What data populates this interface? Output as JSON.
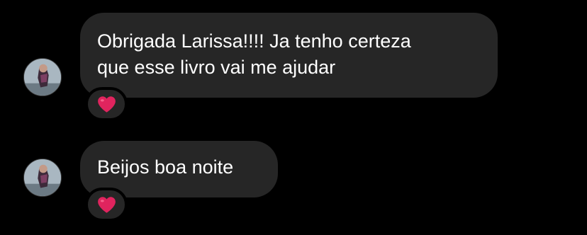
{
  "messages": [
    {
      "lines": [
        "Obrigada Larissa!!!! Ja tenho certeza",
        "que esse livro vai me ajudar"
      ],
      "reaction": "red-heart"
    },
    {
      "lines": [
        "Beijos boa noite"
      ],
      "reaction": "red-heart"
    }
  ],
  "colors": {
    "background": "#000000",
    "bubble": "#262626",
    "text": "#ffffff",
    "heart": "#e0245e"
  }
}
